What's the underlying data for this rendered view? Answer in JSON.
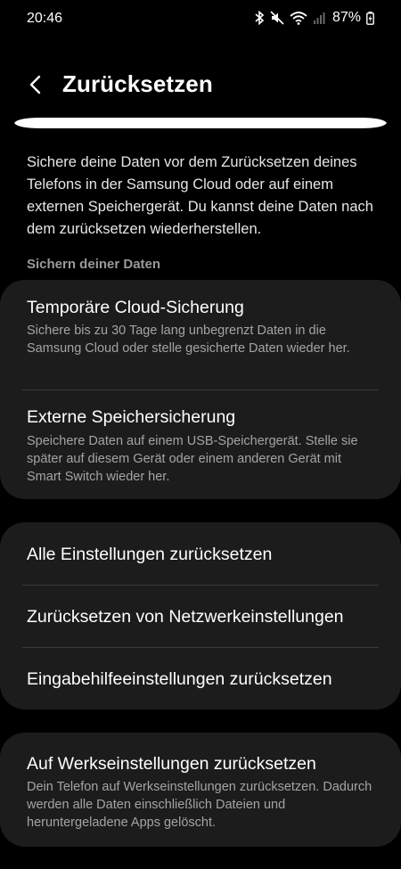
{
  "status": {
    "time": "20:46",
    "battery": "87%",
    "icons": [
      "bluetooth-icon",
      "mute-icon",
      "wifi-icon",
      "signal-icon",
      "battery-charging-icon"
    ]
  },
  "header": {
    "title": "Zurücksetzen",
    "back_icon": "chevron-left-icon"
  },
  "intro": {
    "description": "Sichere deine Daten vor dem Zurücksetzen deines Telefons in der Samsung Cloud oder auf einem externen Speichergerät. Du kannst deine Daten nach dem zurücksetzen wiederherstellen.",
    "section_label": "Sichern deiner Daten"
  },
  "backup": {
    "items": [
      {
        "title": "Temporäre Cloud-Sicherung",
        "subtitle": "Sichere bis zu 30 Tage lang unbegrenzt Daten in die Samsung Cloud oder stelle gesicherte Daten wieder her."
      },
      {
        "title": "Externe Speichersicherung",
        "subtitle": "Speichere Daten auf einem USB-Speichergerät. Stelle sie später auf diesem Gerät oder einem anderen Gerät mit Smart Switch wieder her."
      }
    ]
  },
  "reset": {
    "items": [
      {
        "title": "Alle Einstellungen zurücksetzen"
      },
      {
        "title": "Zurücksetzen von Netzwerkeinstellungen"
      },
      {
        "title": "Eingabehilfeeinstellungen zurücksetzen"
      }
    ]
  },
  "factory": {
    "title": "Auf Werkseinstellungen zurücksetzen",
    "subtitle": "Dein Telefon auf Werkseinstellungen zurücksetzen. Dadurch werden alle Daten einschließlich Dateien und heruntergeladene Apps gelöscht."
  },
  "colors": {
    "background": "#000000",
    "card": "#1c1c1c",
    "secondary_text": "#a4a4a4",
    "highlight": "#ffffff"
  }
}
